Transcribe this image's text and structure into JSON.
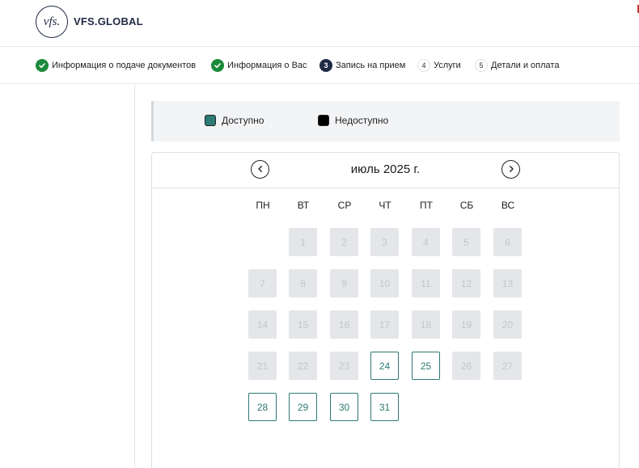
{
  "header": {
    "logo_mark": "vfs.",
    "brand": "VFS.GLOBAL"
  },
  "steps": [
    {
      "label": "Информация о подаче документов",
      "state": "done"
    },
    {
      "label": "Информация о Вас",
      "state": "done"
    },
    {
      "label": "Запись на прием",
      "number": "3",
      "state": "active"
    },
    {
      "label": "Услуги",
      "number": "4",
      "state": "pending"
    },
    {
      "label": "Детали и оплата",
      "number": "5",
      "state": "pending"
    }
  ],
  "legend": {
    "available_label": "Доступно",
    "available_color": "#2e7a74",
    "unavailable_label": "Недоступно",
    "unavailable_color": "#000000"
  },
  "calendar": {
    "month_title": "июль 2025 г.",
    "prev_icon": "chevron-left-icon",
    "next_icon": "chevron-right-icon",
    "weekdays": [
      "ПН",
      "ВТ",
      "СР",
      "ЧТ",
      "ПТ",
      "СБ",
      "ВС"
    ],
    "first_weekday_index": 1,
    "days_in_month": 31,
    "available_days": [
      24,
      25,
      28,
      29,
      30,
      31
    ]
  },
  "colors": {
    "brand_navy": "#1f2a44",
    "step_done_green": "#1a8a3a",
    "available_teal": "#2e7a74",
    "unavailable_gray": "#e4e6e9"
  }
}
